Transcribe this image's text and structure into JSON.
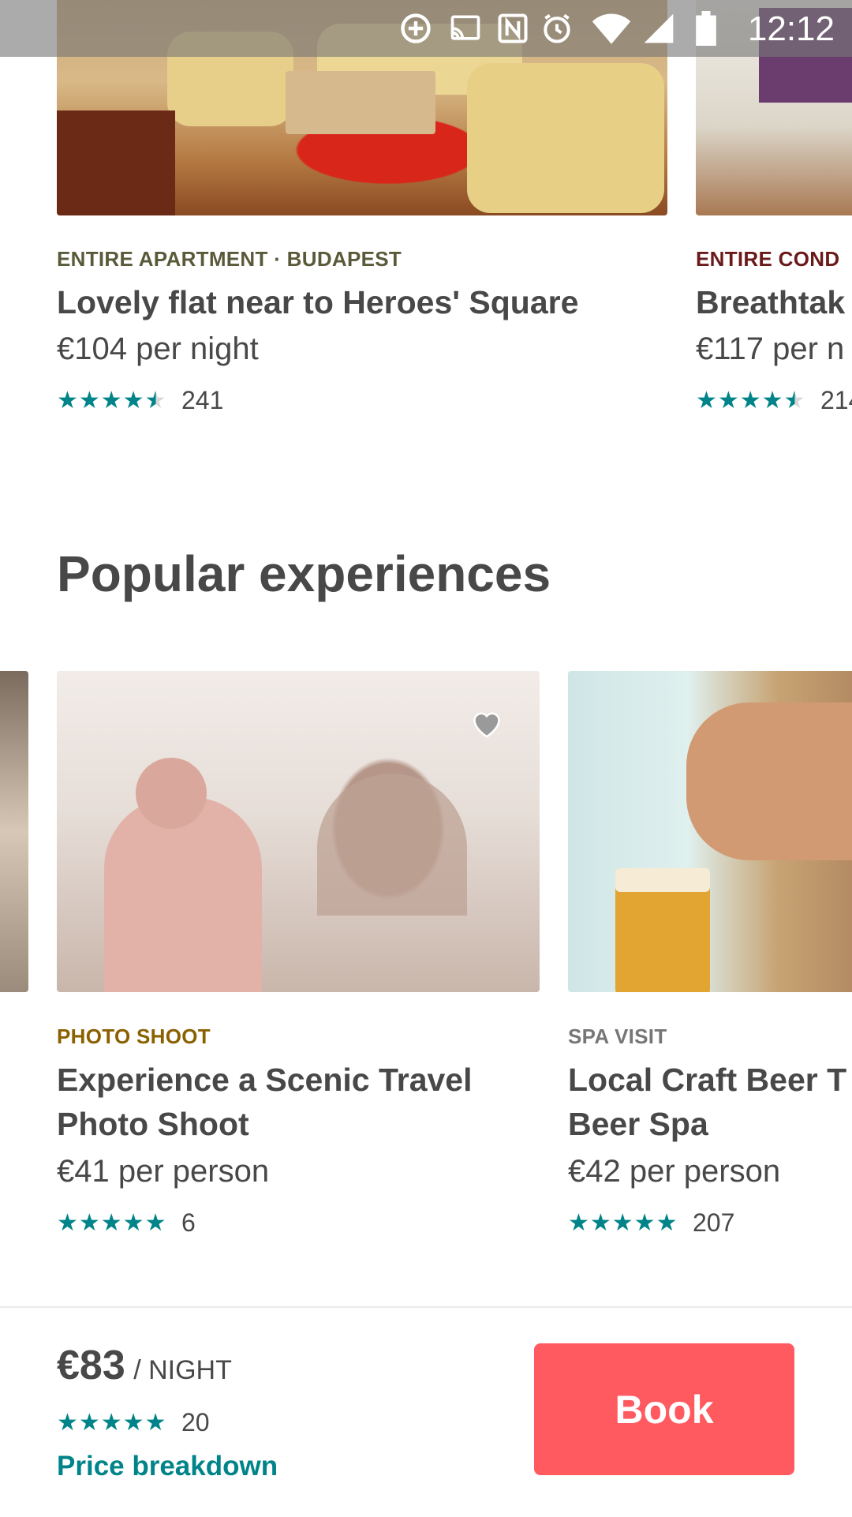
{
  "status_bar": {
    "time": "12:12"
  },
  "homes": [
    {
      "kicker": "ENTIRE APARTMENT · BUDAPEST",
      "kicker_color": "#5a5a3a",
      "title": "Lovely flat near to Heroes' Square",
      "price": "€104 per night",
      "rating_stars": 4.5,
      "reviews": "241"
    },
    {
      "kicker": "ENTIRE COND",
      "kicker_color": "#6b1a1a",
      "title": "Breathtak",
      "price": "€117 per n",
      "rating_stars": 4.5,
      "reviews": "214"
    }
  ],
  "section": {
    "title": "Popular experiences"
  },
  "experiences": [
    {
      "kicker": "PHOTO SHOOT",
      "kicker_color": "#8a6100",
      "title_line1": "Experience a Scenic Travel",
      "title_line2": "Photo Shoot",
      "price": "€41 per person",
      "rating_stars": 5,
      "reviews": "6"
    },
    {
      "kicker": "SPA VISIT",
      "kicker_color": "#767676",
      "title_line1": "Local Craft Beer T",
      "title_line2": "Beer Spa",
      "price": "€42 per person",
      "rating_stars": 5,
      "reviews": "207"
    }
  ],
  "booking": {
    "price": "€83",
    "unit": "/ NIGHT",
    "rating_stars": 5,
    "reviews": "20",
    "breakdown_link": "Price breakdown",
    "book_label": "Book"
  },
  "colors": {
    "accent": "#008489",
    "book_button": "#ff5a5f",
    "text": "#484848"
  }
}
